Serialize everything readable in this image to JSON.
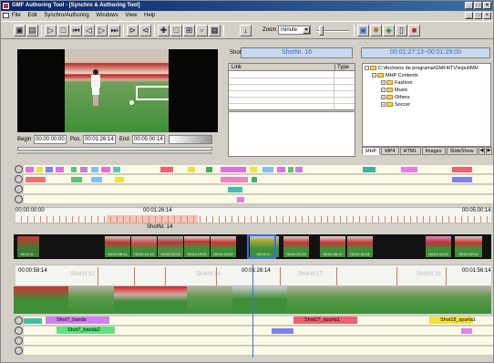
{
  "window": {
    "title": "GMF Authoring Tool - [Synchro & Authoring Tool]",
    "controls": [
      "_",
      "□",
      "×"
    ]
  },
  "menu": [
    "File",
    "Edit",
    "Synchro/Authoring",
    "Windows",
    "View",
    "Help"
  ],
  "toolbar": {
    "zoom_label": "Zoom",
    "zoom_value": "minute"
  },
  "player": {
    "begin_label": "Begin",
    "begin_value": "00:00:00:00",
    "pos_label": "Pos.",
    "pos_value": "00:01:26:14",
    "end_label": "End",
    "end_value": "00:05:00:14"
  },
  "shot": {
    "label": "Shot",
    "name": "ShotNr. 16",
    "timecode": "00:01:27:13~00:01:29:00"
  },
  "links": {
    "col_link": "Link",
    "col_type": "Type"
  },
  "tree": {
    "root": "C:\\Archivos de programa\\GMF4ITV\\input\\MH",
    "group": "MHP Contents",
    "folders": [
      "Fashion",
      "Music",
      "Others",
      "Soccer"
    ]
  },
  "tabs": [
    "MHP",
    "MP4",
    "HTML",
    "Images",
    "SlideShow"
  ],
  "ruler_main": {
    "start": "00:00:00:00",
    "pos": "00:01:26:14",
    "end": "00:05:00:14",
    "shot": "ShotNr. 14"
  },
  "filmstrip": {
    "timecodes": [
      "00:01:0...",
      "00:01:38:14",
      "00:01:12:13",
      "00:01:19:13",
      "00:01:19:05",
      "00:01:24:09",
      "00:01:3...",
      "00:01:31:23",
      "00:01:36:12",
      "00:01:40:01",
      "00:01:44:23",
      "00:01:52:24"
    ]
  },
  "ruler_detail": {
    "start": "00:00:58:14",
    "pos": "00:01:26:14",
    "end": "00:01:56:14",
    "shots": [
      "Shot:N 12",
      "Shot:N 14",
      "Shot:N 17",
      "Shot:N 19"
    ]
  },
  "annotations": {
    "shot7_banda": "Shot7_banda",
    "shot7_banda2": "Shot7_banda2",
    "shot17_sparta": "Shot17_sparta1",
    "shot18_sparta": "Shot18_sparta1"
  }
}
